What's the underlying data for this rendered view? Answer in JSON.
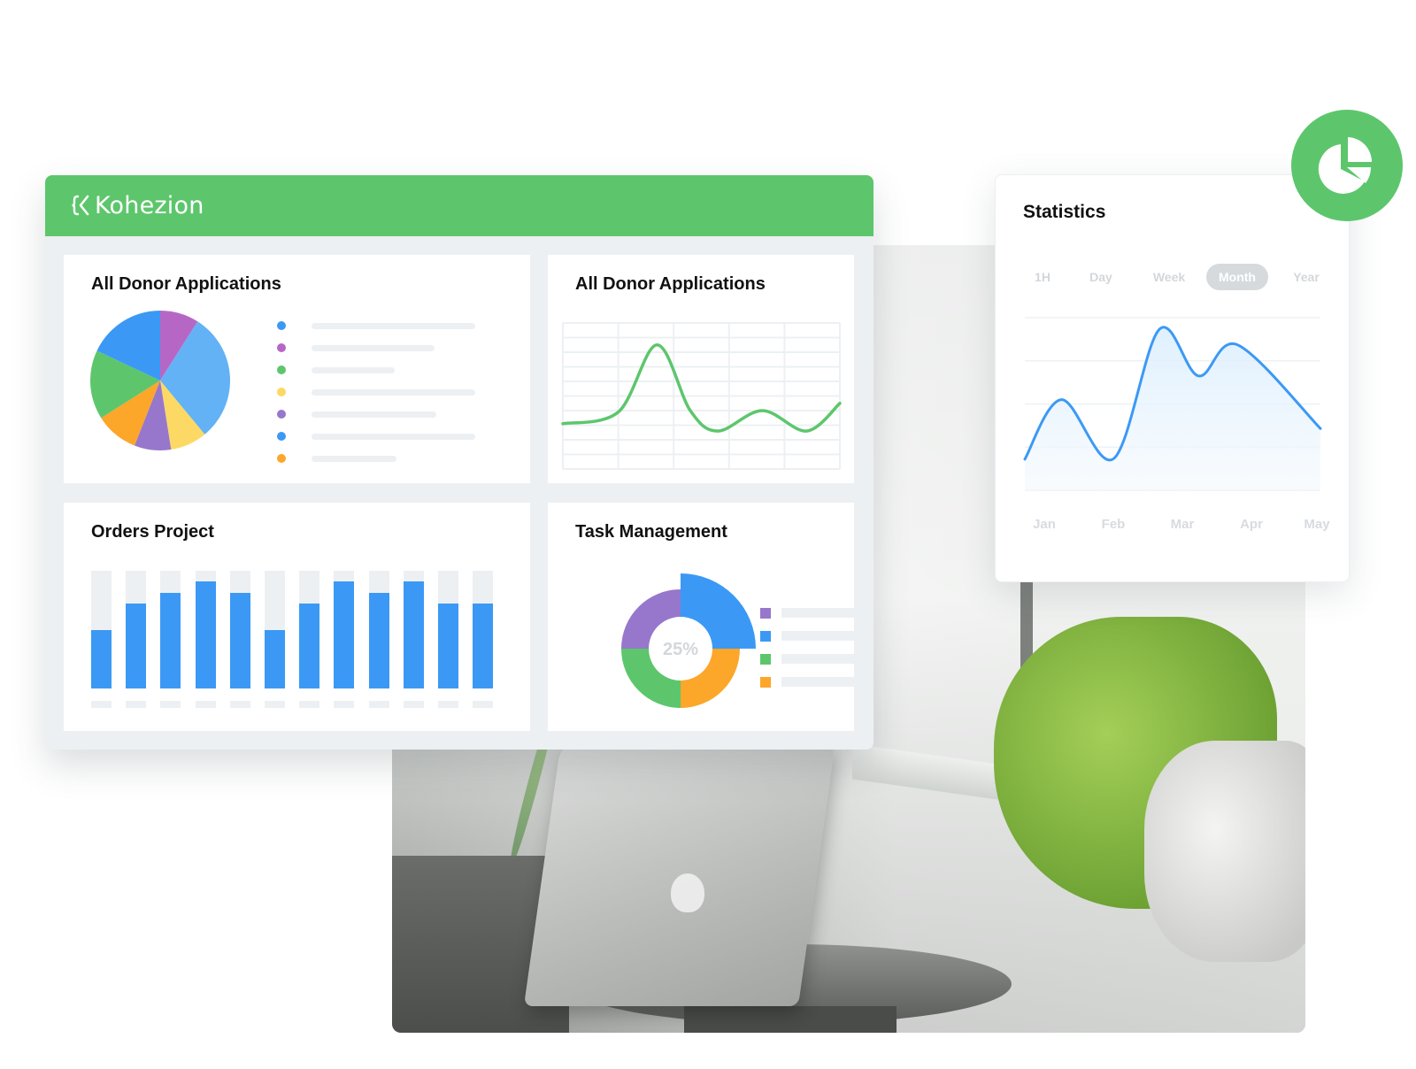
{
  "brand": {
    "name": "Kohezion",
    "logo_icon": "kohezion-bracket-logo"
  },
  "colors": {
    "brand_green": "#5dc66c",
    "blue": "#3b99f5",
    "light_blue": "#62b2f5",
    "magenta": "#b667c6",
    "green": "#5dc66c",
    "yellow": "#fcd964",
    "purple": "#9777cc",
    "orange": "#fca62a",
    "placeholder_gray": "#edf0f3"
  },
  "cards": {
    "pie": {
      "title": "All Donor Applications",
      "legend": [
        {
          "color": "#3b99f5",
          "placeholder_fraction": 1.0
        },
        {
          "color": "#b667c6",
          "placeholder_fraction": 0.75
        },
        {
          "color": "#5dc66c",
          "placeholder_fraction": 0.51
        },
        {
          "color": "#fcd964",
          "placeholder_fraction": 1.0
        },
        {
          "color": "#9777cc",
          "placeholder_fraction": 0.76
        },
        {
          "color": "#3b99f5",
          "placeholder_fraction": 1.0
        },
        {
          "color": "#fca62a",
          "placeholder_fraction": 0.52
        }
      ]
    },
    "line": {
      "title": "All Donor Applications"
    },
    "bars": {
      "title": "Orders Project"
    },
    "task": {
      "title": "Task Management",
      "center_label": "25%",
      "legend_colors": [
        "#9777cc",
        "#3b99f5",
        "#5dc66c",
        "#fca62a"
      ]
    }
  },
  "statistics": {
    "title": "Statistics",
    "tabs": [
      "1H",
      "Day",
      "Week",
      "Month",
      "Year"
    ],
    "active_tab": "Month",
    "fab_icon": "pie-chart-icon"
  },
  "chart_data": [
    {
      "type": "pie",
      "title": "All Donor Applications",
      "categories": [
        "Magenta",
        "Light Blue",
        "Yellow",
        "Purple",
        "Orange",
        "Green",
        "Blue"
      ],
      "values": [
        9,
        30,
        8.5,
        8.5,
        10,
        16,
        18
      ],
      "colors": [
        "#b667c6",
        "#62b2f5",
        "#fcd964",
        "#9777cc",
        "#fca62a",
        "#5dc66c",
        "#3b99f5"
      ],
      "start_angle_deg": 0,
      "direction": "clockwise",
      "legend": "right"
    },
    {
      "type": "line",
      "title": "All Donor Applications",
      "x": [
        0,
        1,
        1.7,
        2.3,
        2.8,
        3.6,
        4.4,
        5
      ],
      "values": [
        3.1,
        3.9,
        8.5,
        4.0,
        2.6,
        4.0,
        2.6,
        4.5
      ],
      "ylim": [
        0,
        10
      ],
      "xlim": [
        0,
        5
      ],
      "grid": true,
      "grid_columns": 5,
      "grid_rows": 10,
      "color": "#5dc66c"
    },
    {
      "type": "bar",
      "title": "Orders Project",
      "categories": [
        "",
        "",
        "",
        "",
        "",
        "",
        "",
        "",
        "",
        "",
        "",
        ""
      ],
      "values": [
        0.5,
        0.72,
        0.81,
        0.91,
        0.81,
        0.5,
        0.72,
        0.91,
        0.81,
        0.91,
        0.72,
        0.72
      ],
      "ylim": [
        0,
        1
      ],
      "color": "#3b99f5",
      "track_color": "#edf0f3"
    },
    {
      "type": "pie",
      "subtype": "donut",
      "title": "Task Management",
      "center_label": "25%",
      "categories": [
        "Blue",
        "Orange",
        "Green",
        "Purple"
      ],
      "values": [
        25,
        25,
        25,
        25
      ],
      "colors": [
        "#3b99f5",
        "#fca62a",
        "#5dc66c",
        "#9777cc"
      ],
      "highlighted": "Blue",
      "legend": "right"
    },
    {
      "type": "area",
      "title": "Statistics",
      "categories": [
        "Jan",
        "Feb",
        "Mar",
        "Apr",
        "May"
      ],
      "x": [
        0,
        0.5,
        1.2,
        1.82,
        2.35,
        2.88,
        4.0
      ],
      "values": [
        0.72,
        2.1,
        0.73,
        3.73,
        2.65,
        3.37,
        1.43
      ],
      "ylim": [
        0,
        4
      ],
      "xlim": [
        0,
        4
      ],
      "grid": true,
      "color": "#3b99f5"
    }
  ]
}
